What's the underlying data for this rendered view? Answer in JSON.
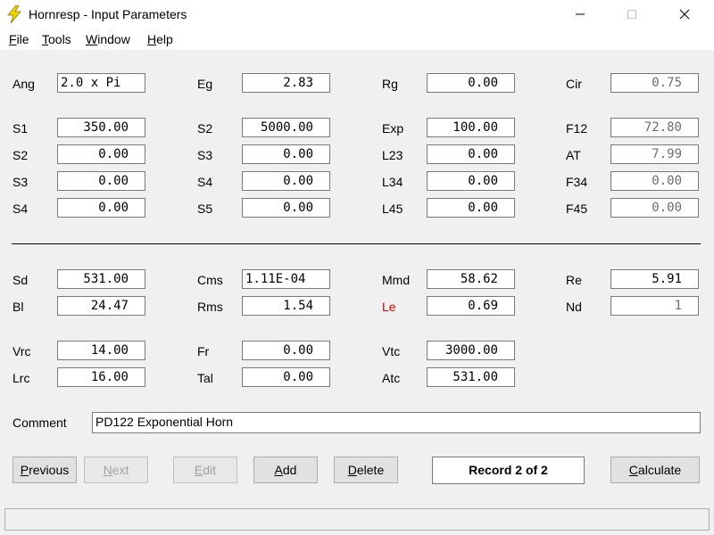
{
  "window": {
    "title": "Hornresp - Input Parameters"
  },
  "menu": [
    {
      "label": "File",
      "mnemonic": "F",
      "rest": "ile"
    },
    {
      "label": "Tools",
      "mnemonic": "T",
      "rest": "ools"
    },
    {
      "label": "Window",
      "mnemonic": "W",
      "rest": "indow"
    },
    {
      "label": "Help",
      "mnemonic": "H",
      "rest": "elp"
    }
  ],
  "horn": {
    "ang": {
      "label": "Ang",
      "value": "2.0 x Pi"
    },
    "eg": {
      "label": "Eg",
      "value": "2.83"
    },
    "rg": {
      "label": "Rg",
      "value": "0.00"
    },
    "cir": {
      "label": "Cir",
      "value": "0.75"
    },
    "s1": {
      "label": "S1",
      "value": "350.00"
    },
    "s2a": {
      "label": "S2",
      "value": "5000.00"
    },
    "exp": {
      "label": "Exp",
      "value": "100.00"
    },
    "f12": {
      "label": "F12",
      "value": "72.80"
    },
    "s2b": {
      "label": "S2",
      "value": "0.00"
    },
    "s3a": {
      "label": "S3",
      "value": "0.00"
    },
    "l23": {
      "label": "L23",
      "value": "0.00"
    },
    "at": {
      "label": "AT",
      "value": "7.99"
    },
    "s3b": {
      "label": "S3",
      "value": "0.00"
    },
    "s4a": {
      "label": "S4",
      "value": "0.00"
    },
    "l34": {
      "label": "L34",
      "value": "0.00"
    },
    "f34": {
      "label": "F34",
      "value": "0.00"
    },
    "s4b": {
      "label": "S4",
      "value": "0.00"
    },
    "s5": {
      "label": "S5",
      "value": "0.00"
    },
    "l45": {
      "label": "L45",
      "value": "0.00"
    },
    "f45": {
      "label": "F45",
      "value": "0.00"
    }
  },
  "driver": {
    "sd": {
      "label": "Sd",
      "value": "531.00"
    },
    "cms": {
      "label": "Cms",
      "value": "1.11E-04"
    },
    "mmd": {
      "label": "Mmd",
      "value": "58.62"
    },
    "re": {
      "label": "Re",
      "value": "5.91"
    },
    "bl": {
      "label": "Bl",
      "value": "24.47"
    },
    "rms": {
      "label": "Rms",
      "value": "1.54"
    },
    "le": {
      "label": "Le",
      "value": "0.69"
    },
    "nd": {
      "label": "Nd",
      "value": "1"
    }
  },
  "chambers": {
    "vrc": {
      "label": "Vrc",
      "value": "14.00"
    },
    "fr": {
      "label": "Fr",
      "value": "0.00"
    },
    "vtc": {
      "label": "Vtc",
      "value": "3000.00"
    },
    "lrc": {
      "label": "Lrc",
      "value": "16.00"
    },
    "tal": {
      "label": "Tal",
      "value": "0.00"
    },
    "atc": {
      "label": "Atc",
      "value": "531.00"
    }
  },
  "comment": {
    "label": "Comment",
    "value": "PD122 Exponential Horn"
  },
  "buttons": {
    "previous": {
      "label": "Previous",
      "mnemonic": "P",
      "rest": "revious"
    },
    "next": {
      "label": "Next",
      "mnemonic": "N",
      "rest": "ext"
    },
    "edit": {
      "label": "Edit",
      "mnemonic": "E",
      "rest": "dit"
    },
    "add": {
      "label": "Add",
      "mnemonic": "A",
      "rest": "dd"
    },
    "delete": {
      "label": "Delete",
      "mnemonic": "D",
      "rest": "elete"
    },
    "calculate": {
      "label": "Calculate",
      "mnemonic": "C",
      "rest": "alculate"
    }
  },
  "record": {
    "text": "Record 2 of 2"
  },
  "colors": {
    "le_label": "#e00000",
    "readonly_text": "#6d6d6d",
    "icon": "#f5d800"
  }
}
